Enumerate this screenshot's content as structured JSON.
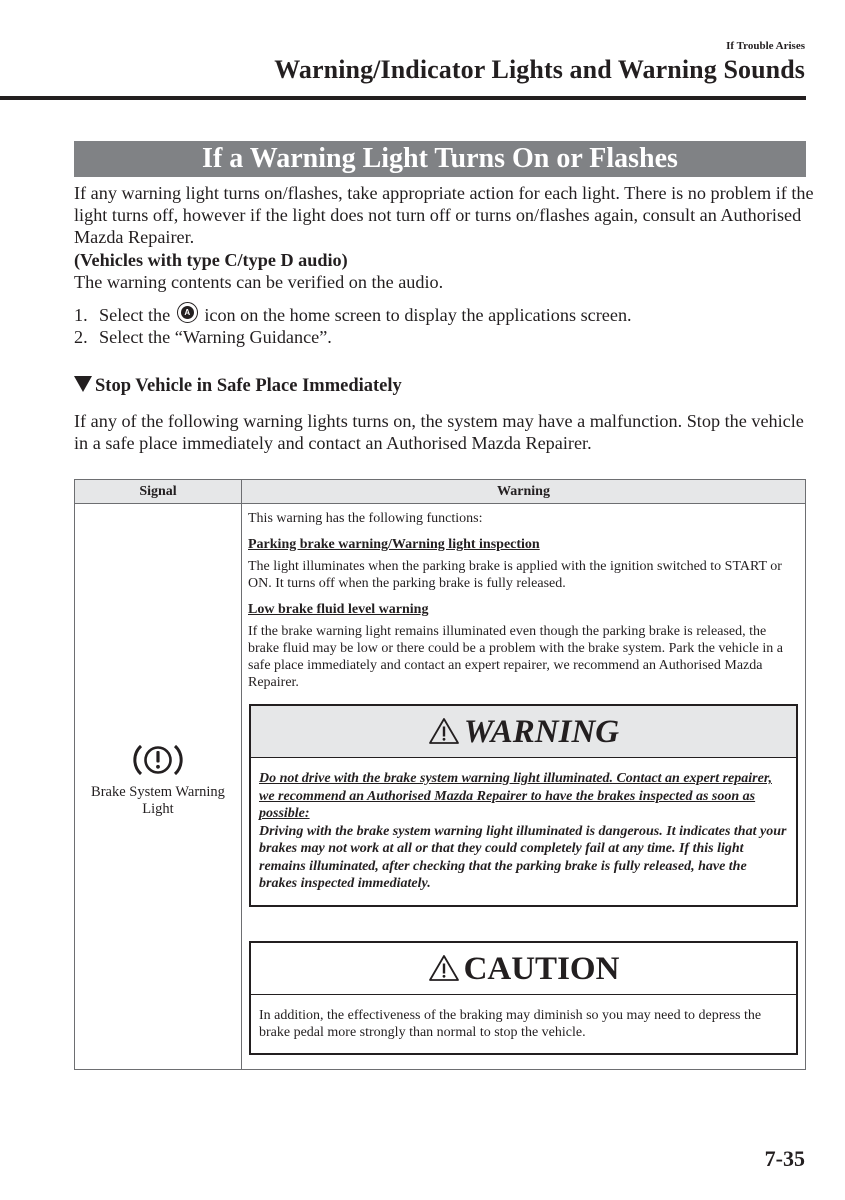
{
  "header": {
    "section_label": "If Trouble Arises",
    "page_title": "Warning/Indicator Lights and Warning Sounds"
  },
  "banner": {
    "title": "If a Warning Light Turns On or Flashes"
  },
  "intro": {
    "paragraph": "If any warning light turns on/flashes, take appropriate action for each light. There is no problem if the light turns off, however if the light does not turn off or turns on/flashes again, consult an Authorised Mazda Repairer.",
    "vehicles_note": "(Vehicles with type C/type D audio)",
    "verify_text": "The warning contents can be verified on the audio.",
    "steps": [
      {
        "num": "1.",
        "before_icon": "Select the",
        "icon": "applications-icon",
        "icon_glyph": "A",
        "after_icon": "icon on the home screen to display the applications screen."
      },
      {
        "num": "2.",
        "text": "Select the “Warning Guidance”."
      }
    ]
  },
  "section": {
    "heading": "Stop Vehicle in Safe Place Immediately",
    "heading_icon": "triangle-down-icon",
    "paragraph": "If any of the following warning lights turns on, the system may have a malfunction. Stop the vehicle in a safe place immediately and contact an Authorised Mazda Repairer."
  },
  "table": {
    "headers": [
      "Signal",
      "Warning"
    ],
    "rows": [
      {
        "signal_icon": "brake-warning-icon",
        "signal_label": "Brake System Warning Light",
        "intro": "This warning has the following functions:",
        "functions": [
          {
            "title": "Parking brake warning/Warning light inspection",
            "text": "The light illuminates when the parking brake is applied with the ignition switched to START or ON. It turns off when the parking brake is fully released."
          },
          {
            "title": "Low brake fluid level warning",
            "text": "If the brake warning light remains illuminated even though the parking brake is released, the brake fluid may be low or there could be a problem with the brake system. Park the vehicle in a safe place immediately and contact an expert repairer, we recommend an Authorised Mazda Repairer."
          }
        ],
        "warning_box": {
          "title": "WARNING",
          "icon": "warning-triangle-icon",
          "underlined_text": "Do not drive with the brake system warning light illuminated. Contact an expert repairer, we recommend an Authorised Mazda Repairer to have the brakes inspected as soon as possible:",
          "text": "Driving with the brake system warning light illuminated is dangerous. It indicates that your brakes may not work at all or that they could completely fail at any time. If this light remains illuminated, after checking that the parking brake is fully released, have the brakes inspected immediately."
        },
        "caution_box": {
          "title": "CAUTION",
          "icon": "caution-triangle-icon",
          "text": "In addition, the effectiveness of the braking may diminish so you may need to depress the brake pedal more strongly than normal to stop the vehicle."
        }
      }
    ]
  },
  "footer": {
    "page_number": "7-35"
  }
}
